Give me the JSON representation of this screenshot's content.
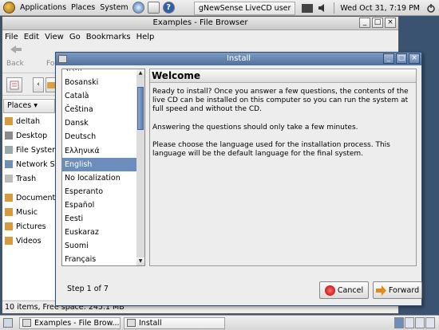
{
  "top_panel": {
    "menus": [
      "Applications",
      "Places",
      "System"
    ],
    "task_title": "gNewSense LiveCD user",
    "clock": "Wed Oct 31,  7:19 PM"
  },
  "file_browser": {
    "title": "Examples - File Browser",
    "menu": [
      "File",
      "Edit",
      "View",
      "Go",
      "Bookmarks",
      "Help"
    ],
    "toolbar": {
      "back": "Back",
      "forward": "Fo"
    },
    "places_label": "Places ▾",
    "places": [
      {
        "label": "deltah",
        "icon": "home-icon"
      },
      {
        "label": "Desktop",
        "icon": "desktop-icon"
      },
      {
        "label": "File System",
        "icon": "drive-icon"
      },
      {
        "label": "Network Se",
        "icon": "network-icon"
      },
      {
        "label": "Trash",
        "icon": "trash-icon"
      },
      {
        "label": "Documents",
        "icon": "folder-icon"
      },
      {
        "label": "Music",
        "icon": "folder-icon"
      },
      {
        "label": "Pictures",
        "icon": "folder-icon"
      },
      {
        "label": "Videos",
        "icon": "folder-icon"
      }
    ],
    "status": "10 items, Free space: 245.1 MB"
  },
  "install": {
    "title": "Install",
    "languages": [
      "বাংলা",
      "Bosanski",
      "Català",
      "Čeština",
      "Dansk",
      "Deutsch",
      "Ελληνικά",
      "English",
      "No localization",
      "Esperanto",
      "Español",
      "Eesti",
      "Euskaraz",
      "Suomi",
      "Français"
    ],
    "selected_language": "English",
    "heading": "Welcome",
    "paragraphs": [
      "Ready to install? Once you answer a few questions, the contents of the live CD can be installed on this computer so you can run the system at full speed and without the CD.",
      "Answering the questions should only take a few minutes.",
      "Please choose the language used for the installation process. This language will be the default language for the final system."
    ],
    "step": "Step 1 of 7",
    "cancel_label": "Cancel",
    "forward_label": "Forward"
  },
  "bottom_panel": {
    "tasks": [
      "Examples - File Brow...",
      "Install"
    ]
  },
  "colors": {
    "title_active": "#5a7aa6",
    "selection": "#6d8dbd",
    "desktop": "#3a5370"
  }
}
